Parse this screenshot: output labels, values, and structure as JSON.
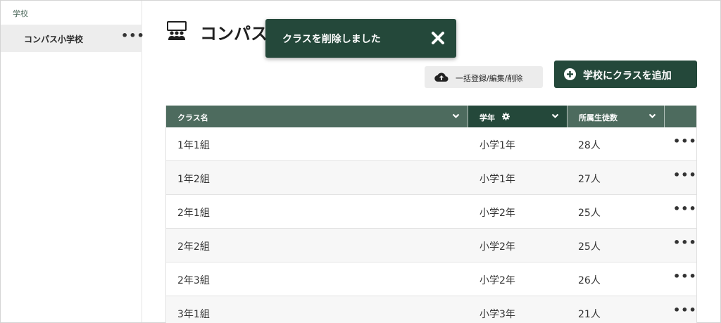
{
  "sidebar": {
    "heading": "学校",
    "items": [
      {
        "label": "コンパス小学校",
        "more": "•••"
      }
    ]
  },
  "page": {
    "title": "コンパス"
  },
  "toast": {
    "message": "クラスを削除しました"
  },
  "toolbar": {
    "bulk_label": "一括登録/編集/削除",
    "add_label": "学校にクラスを追加"
  },
  "table": {
    "columns": [
      {
        "label": "クラス名"
      },
      {
        "label": "学年"
      },
      {
        "label": "所属生徒数"
      }
    ],
    "rows": [
      {
        "name": "1年1組",
        "grade": "小学1年",
        "count": "28人",
        "more": "•••"
      },
      {
        "name": "1年2組",
        "grade": "小学1年",
        "count": "27人",
        "more": "•••"
      },
      {
        "name": "2年1組",
        "grade": "小学2年",
        "count": "25人",
        "more": "•••"
      },
      {
        "name": "2年2組",
        "grade": "小学2年",
        "count": "25人",
        "more": "•••"
      },
      {
        "name": "2年3組",
        "grade": "小学2年",
        "count": "26人",
        "more": "•••"
      },
      {
        "name": "3年1組",
        "grade": "小学3年",
        "count": "21人",
        "more": "•••"
      }
    ]
  },
  "colors": {
    "primary": "#24483a",
    "header": "#4d6b5e",
    "row_alt": "#f7f7f7"
  },
  "icons": {
    "title": "classroom-icon",
    "toast_close": "close-icon",
    "bulk": "cloud-upload-icon",
    "add": "plus-circle-icon",
    "sort": "chevron-down-icon",
    "settings": "gear-icon"
  }
}
